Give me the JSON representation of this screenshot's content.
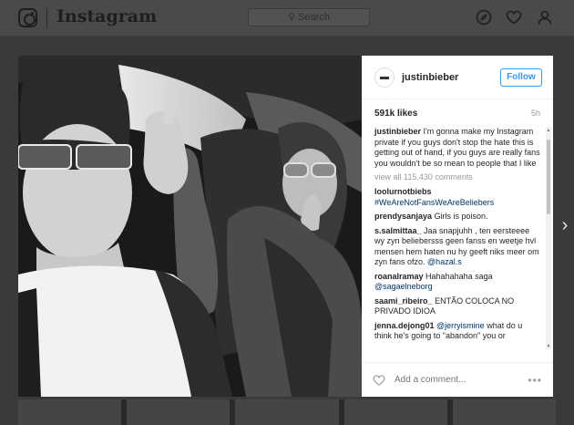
{
  "header": {
    "wordmark": "Instagram",
    "search_placeholder": "Search"
  },
  "post": {
    "username": "justinbieber",
    "follow_label": "Follow",
    "likes": "591k likes",
    "time": "5h",
    "caption_user": "justinbieber",
    "caption_text": "I'm gonna make my Instagram private if you guys don't stop the hate this is getting out of hand, if you guys are really fans you wouldn't be so mean to people that I like",
    "view_all": "view all 115,430 comments",
    "comment_placeholder": "Add a comment...",
    "more_label": "•••"
  },
  "comments": [
    {
      "user": "loolurnotbiebs",
      "text": "",
      "mention": "#WeAreNotFansWeAreBeliebers"
    },
    {
      "user": "prendysanjaya",
      "text": "Girls is poison.",
      "mention": ""
    },
    {
      "user": "s.salmittaa_",
      "text": "Jaa snapjuhh , ten eersteeee wy zyn beliebersss geen fanss en weetje hvl mensen hem haten nu hy geeft niks meer om zyn fans ofzo.",
      "mention": "@hazal.s"
    },
    {
      "user": "roanalramay",
      "text": "Hahahahaha saga",
      "mention": "@sagaelneborg"
    },
    {
      "user": "saami_ribeiro_",
      "text": "ENTÃO COLOCA NO PRIVADO IDIOA",
      "mention": ""
    },
    {
      "user": "jenna.dejong01",
      "text": "what do u think he's going to \"abandon\" you or",
      "mention": "@jerryismine"
    }
  ],
  "colors": {
    "follow_blue": "#3897f0",
    "mention_blue": "#003569"
  }
}
